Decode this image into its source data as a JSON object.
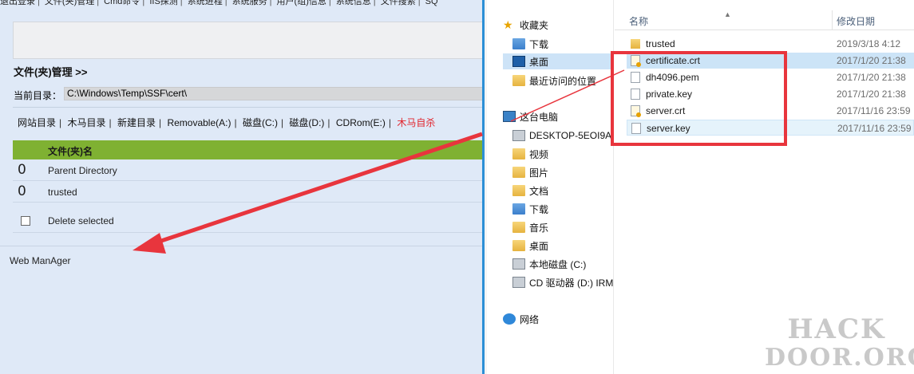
{
  "left": {
    "topnav": [
      "退出登录",
      "文件(夹)管理",
      "Cmd命令",
      "IIS探测",
      "系统进程",
      "系统服务",
      "用户(组)信息",
      "系统信息",
      "文件搜索",
      "SQ"
    ],
    "section_title": "文件(夹)管理 >>",
    "current_dir_label": "当前目录：",
    "current_dir_value": "C:\\Windows\\Temp\\SSF\\cert\\",
    "drive_links": [
      {
        "label": "网站目录",
        "color": "default"
      },
      {
        "label": "木马目录",
        "color": "default"
      },
      {
        "label": "新建目录",
        "color": "default"
      },
      {
        "label": "Removable(A:)",
        "color": "default"
      },
      {
        "label": "磁盘(C:)",
        "color": "default"
      },
      {
        "label": "磁盘(D:)",
        "color": "default"
      },
      {
        "label": "CDRom(E:)",
        "color": "default"
      },
      {
        "label": "木马自杀",
        "color": "#e0242c"
      }
    ],
    "table_header": "文件(夹)名",
    "rows": [
      {
        "num": "0",
        "name": "Parent Directory"
      },
      {
        "num": "0",
        "name": "trusted"
      }
    ],
    "delete_label": "Delete selected",
    "footer": "Web ManAger"
  },
  "right": {
    "nav": [
      {
        "label": "收藏夹",
        "icon": "star-icon"
      },
      {
        "label": "下载",
        "icon": "download-folder-icon"
      },
      {
        "label": "桌面",
        "icon": "desktop-icon"
      },
      {
        "label": "最近访问的位置",
        "icon": "recent-places-icon"
      },
      {
        "label": "这台电脑",
        "icon": "computer-icon"
      },
      {
        "label": "DESKTOP-5EOI9A",
        "icon": "network-pc-icon"
      },
      {
        "label": "视频",
        "icon": "videos-folder-icon"
      },
      {
        "label": "图片",
        "icon": "pictures-folder-icon"
      },
      {
        "label": "文档",
        "icon": "documents-folder-icon"
      },
      {
        "label": "下载",
        "icon": "download-folder-icon"
      },
      {
        "label": "音乐",
        "icon": "music-folder-icon"
      },
      {
        "label": "桌面",
        "icon": "desktop-icon"
      },
      {
        "label": "本地磁盘 (C:)",
        "icon": "drive-icon"
      },
      {
        "label": "CD 驱动器 (D:) IRM",
        "icon": "cd-drive-icon"
      },
      {
        "label": "网络",
        "icon": "network-icon"
      }
    ],
    "col_name": "名称",
    "col_date": "修改日期",
    "files": [
      {
        "name": "trusted",
        "date": "2019/3/18 4:12",
        "type": "folder"
      },
      {
        "name": "certificate.crt",
        "date": "2017/1/20 21:38",
        "type": "cert"
      },
      {
        "name": "dh4096.pem",
        "date": "2017/1/20 21:38",
        "type": "doc"
      },
      {
        "name": "private.key",
        "date": "2017/1/20 21:38",
        "type": "doc"
      },
      {
        "name": "server.crt",
        "date": "2017/11/16 23:59",
        "type": "cert"
      },
      {
        "name": "server.key",
        "date": "2017/11/16 23:59",
        "type": "doc"
      }
    ]
  },
  "watermark": {
    "line1": "HACK",
    "line2": "DOOR.ORG"
  },
  "colors": {
    "table_header": "#7fb132",
    "annotation_red": "#e8353d",
    "selection": "#cce4f7",
    "left_bg": "#dfe9f7"
  }
}
